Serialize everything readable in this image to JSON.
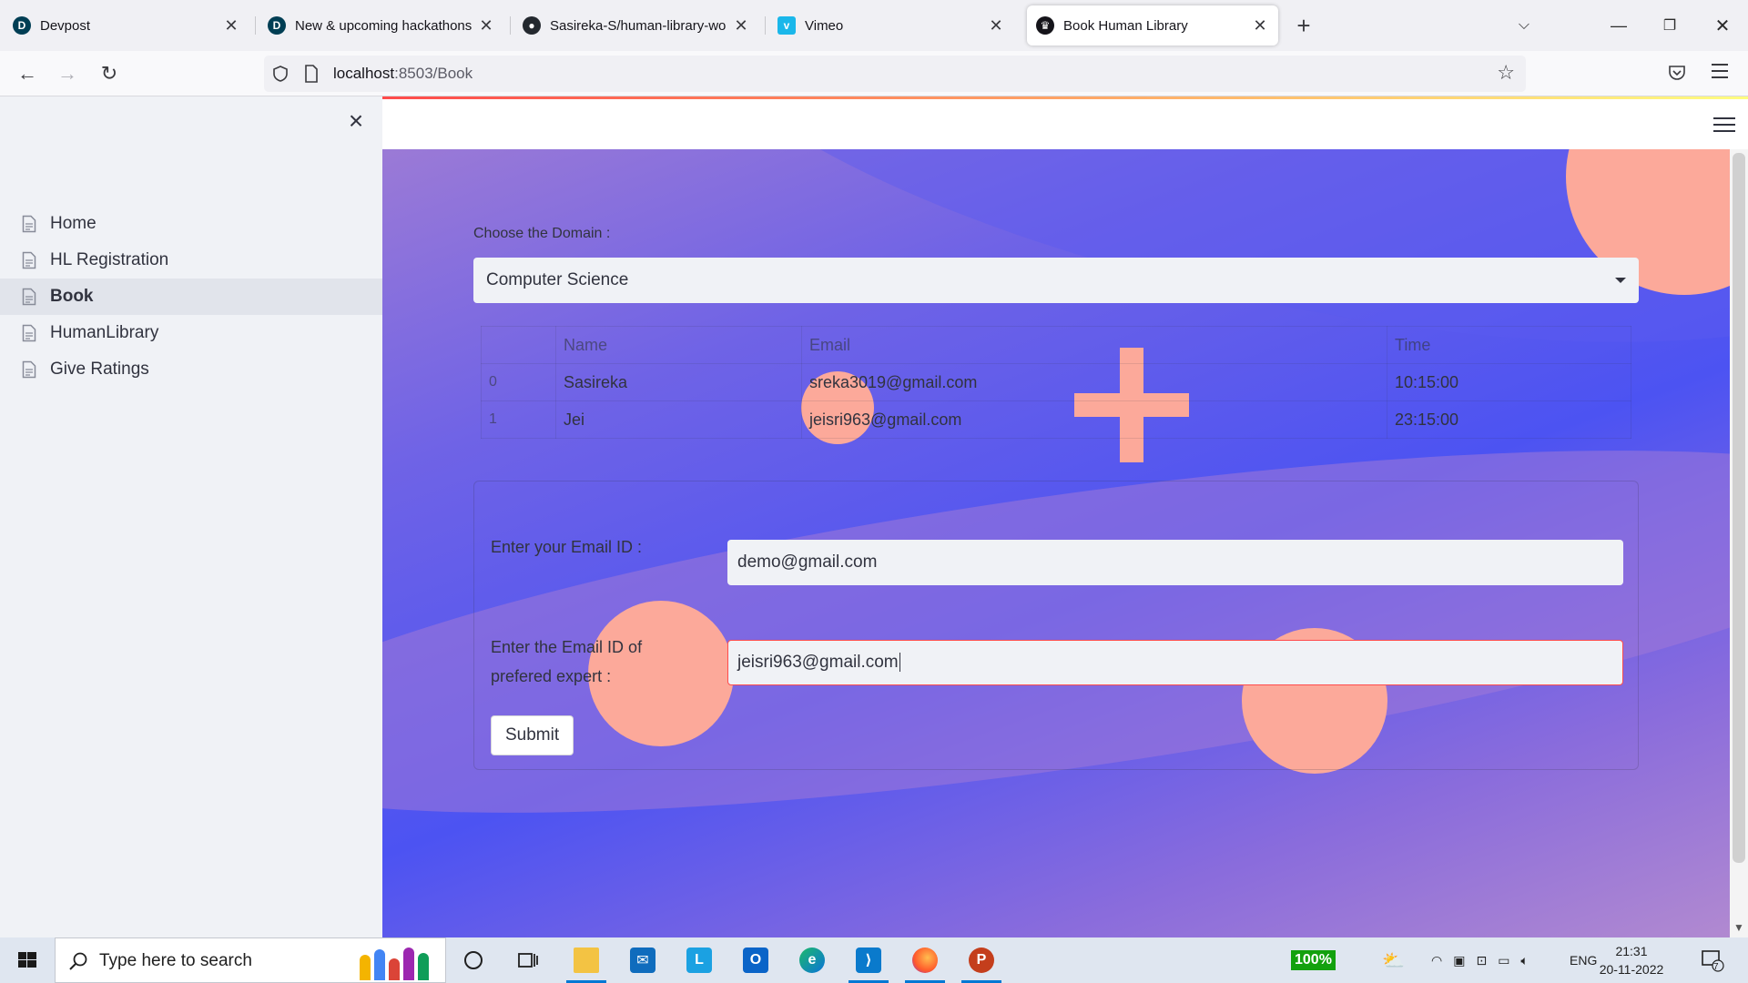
{
  "browser": {
    "tabs": [
      {
        "title": "Devpost",
        "favicon": "devpost-icon",
        "active": false
      },
      {
        "title": "New & upcoming hackathons · [",
        "favicon": "devpost-icon",
        "active": false
      },
      {
        "title": "Sasireka-S/human-library-world",
        "favicon": "github-icon",
        "active": false
      },
      {
        "title": "Vimeo",
        "favicon": "vimeo-icon",
        "active": false
      },
      {
        "title": "Book Human Library",
        "favicon": "streamlit-icon",
        "active": true
      }
    ],
    "url_host": "localhost",
    "url_rest": ":8503/Book"
  },
  "sidebar": {
    "items": [
      {
        "label": "Home",
        "active": false
      },
      {
        "label": "HL Registration",
        "active": false
      },
      {
        "label": "Book",
        "active": true
      },
      {
        "label": "HumanLibrary",
        "active": false
      },
      {
        "label": "Give Ratings",
        "active": false
      }
    ]
  },
  "main": {
    "domain_label": "Choose the Domain :",
    "domain_value": "Computer Science",
    "table": {
      "headers": [
        "",
        "Name",
        "Email",
        "Time"
      ],
      "rows": [
        [
          "0",
          "Sasireka",
          "sreka3019@gmail.com",
          "10:15:00"
        ],
        [
          "1",
          "Jei",
          "jeisri963@gmail.com",
          "23:15:00"
        ]
      ]
    },
    "form": {
      "email_label": "Enter your Email ID :",
      "email_value": "demo@gmail.com",
      "expert_label_line1": "Enter the Email ID of",
      "expert_label_line2": "prefered expert :",
      "expert_value": "jeisri963@gmail.com",
      "submit_label": "Submit"
    }
  },
  "taskbar": {
    "search_placeholder": "Type here to search",
    "battery": "100%",
    "language": "ENG",
    "time": "21:31",
    "date": "20-11-2022",
    "notification_count": "7"
  },
  "colors": {
    "accent": "#ff4b4b",
    "sidebar_bg": "#f0f2f6",
    "blob": "#fca99a",
    "bg_blue": "#4c53f2"
  }
}
